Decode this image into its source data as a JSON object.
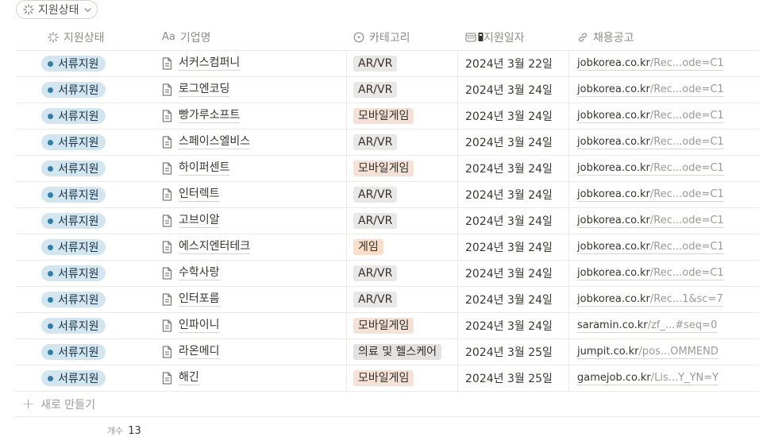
{
  "filter": {
    "label": "지원상태"
  },
  "columns": {
    "status": "지원상태",
    "name_prefix": "Aa",
    "name": "기업명",
    "category": "카테고리",
    "date": "지원일자",
    "link": "채용공고"
  },
  "colors": {
    "status_bg": "#d3e5ef",
    "status_dot": "#337ea9",
    "tag_default": "#e3e2e0",
    "tag_brown": "#f4e2d9",
    "tag_orange": "#fadec9"
  },
  "rows": [
    {
      "status": "서류지원",
      "name": "서커스컴퍼니",
      "category": "AR/VR",
      "cat_color": "#e9e8e6",
      "date": "2024년 3월 22일",
      "link_host": "jobkorea.co.kr",
      "link_rest": "/Rec...ode=C1"
    },
    {
      "status": "서류지원",
      "name": "로그엔코딩",
      "category": "AR/VR",
      "cat_color": "#e9e8e6",
      "date": "2024년 3월 24일",
      "link_host": "jobkorea.co.kr",
      "link_rest": "/Rec...ode=C1"
    },
    {
      "status": "서류지원",
      "name": "빵가루소프트",
      "category": "모바일게임",
      "cat_color": "#f4e2d9",
      "date": "2024년 3월 24일",
      "link_host": "jobkorea.co.kr",
      "link_rest": "/Rec...ode=C1"
    },
    {
      "status": "서류지원",
      "name": "스페이스엘비스",
      "category": "AR/VR",
      "cat_color": "#e9e8e6",
      "date": "2024년 3월 24일",
      "link_host": "jobkorea.co.kr",
      "link_rest": "/Rec...ode=C1"
    },
    {
      "status": "서류지원",
      "name": "하이퍼센트",
      "category": "모바일게임",
      "cat_color": "#f4e2d9",
      "date": "2024년 3월 24일",
      "link_host": "jobkorea.co.kr",
      "link_rest": "/Rec...ode=C1"
    },
    {
      "status": "서류지원",
      "name": "인터렉트",
      "category": "AR/VR",
      "cat_color": "#e9e8e6",
      "date": "2024년 3월 24일",
      "link_host": "jobkorea.co.kr",
      "link_rest": "/Rec...ode=C1"
    },
    {
      "status": "서류지원",
      "name": "고브이알",
      "category": "AR/VR",
      "cat_color": "#e9e8e6",
      "date": "2024년 3월 24일",
      "link_host": "jobkorea.co.kr",
      "link_rest": "/Rec...ode=C1"
    },
    {
      "status": "서류지원",
      "name": "에스지엔터테크",
      "category": "게임",
      "cat_color": "#fadec9",
      "date": "2024년 3월 24일",
      "link_host": "jobkorea.co.kr",
      "link_rest": "/Rec...ode=C1"
    },
    {
      "status": "서류지원",
      "name": "수학사랑",
      "category": "AR/VR",
      "cat_color": "#e9e8e6",
      "date": "2024년 3월 24일",
      "link_host": "jobkorea.co.kr",
      "link_rest": "/Rec...ode=C1"
    },
    {
      "status": "서류지원",
      "name": "인터포름",
      "category": "AR/VR",
      "cat_color": "#e9e8e6",
      "date": "2024년 3월 24일",
      "link_host": "jobkorea.co.kr",
      "link_rest": "/Rec...1&sc=7"
    },
    {
      "status": "서류지원",
      "name": "인파이니",
      "category": "모바일게임",
      "cat_color": "#f4e2d9",
      "date": "2024년 3월 24일",
      "link_host": "saramin.co.kr",
      "link_rest": "/zf_...#seq=0"
    },
    {
      "status": "서류지원",
      "name": "라온메디",
      "category": "의료 및 헬스케어",
      "cat_color": "#e3e2e0",
      "date": "2024년 3월 25일",
      "link_host": "jumpit.co.kr",
      "link_rest": "/pos...OMMEND"
    },
    {
      "status": "서류지원",
      "name": "해긴",
      "category": "모바일게임",
      "cat_color": "#f4e2d9",
      "date": "2024년 3월 25일",
      "link_host": "gamejob.co.kr",
      "link_rest": "/Lis...Y_YN=Y"
    }
  ],
  "new_row": {
    "label": "새로 만들기"
  },
  "footer": {
    "count_label": "개수",
    "count_value": "13"
  }
}
